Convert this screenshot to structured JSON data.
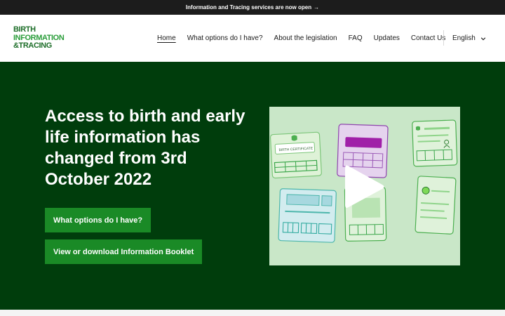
{
  "announcement": {
    "text": "Information and Tracing services are now open",
    "arrow": "→"
  },
  "logo": {
    "line1": "BIRTH",
    "line2": "INFORMATION",
    "line3": "&TRACING"
  },
  "nav": {
    "items": [
      {
        "label": "Home",
        "active": true
      },
      {
        "label": "What options do I have?"
      },
      {
        "label": "About the legislation"
      },
      {
        "label": "FAQ"
      },
      {
        "label": "Updates"
      },
      {
        "label": "Contact Us"
      }
    ],
    "language": "English"
  },
  "hero": {
    "heading": "Access to birth and early life information has changed from 3rd October 2022",
    "button_primary": "What options do I have?",
    "button_secondary": "View or download Information Booklet"
  },
  "video": {
    "card_label": "BIRTH CERTIFICATE",
    "icon": "play-icon"
  },
  "colors": {
    "hero_bg": "#003d0c",
    "button": "#1a8a26",
    "topbar": "#1c1c1c",
    "video_bg": "#c9e7c8"
  }
}
